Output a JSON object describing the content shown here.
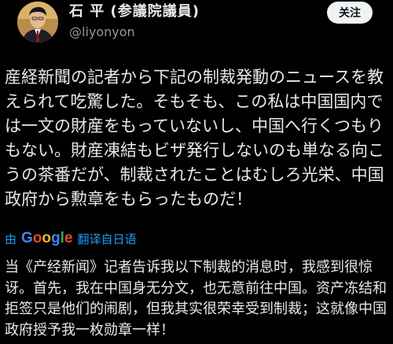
{
  "author": {
    "display_name": "石 平 (参議院議員)",
    "handle": "@liyonyon",
    "avatar": "person-avatar"
  },
  "follow_button": {
    "label": "关注"
  },
  "post": {
    "text": "産経新聞の記者から下記の制裁発動のニュースを教えられて吃驚した。そもそも、この私は中国国内では一文の財産をもっていないし、中国へ行くつもりもない。財産凍結もビザ発行しないのも単なる向こうの茶番だが、制裁されたことはむしろ光栄、中国政府から勲章をもらったものだ！"
  },
  "translation": {
    "by_label": "由",
    "provider": "Google",
    "action_label": "翻译自日语",
    "text": "当《产经新闻》记者告诉我以下制裁的消息时，我感到很惊讶。首先，我在中国身无分文，也无意前往中国。资产冻结和拒签只是他们的闹剧，但我其实很荣幸受到制裁；这就像中国政府授予我一枚勋章一样！"
  },
  "colors": {
    "background": "#000000",
    "text": "#e7e9ea",
    "secondary_text": "#8b98a5",
    "link": "#1d9bf0",
    "follow_bg": "#eff3f4"
  }
}
